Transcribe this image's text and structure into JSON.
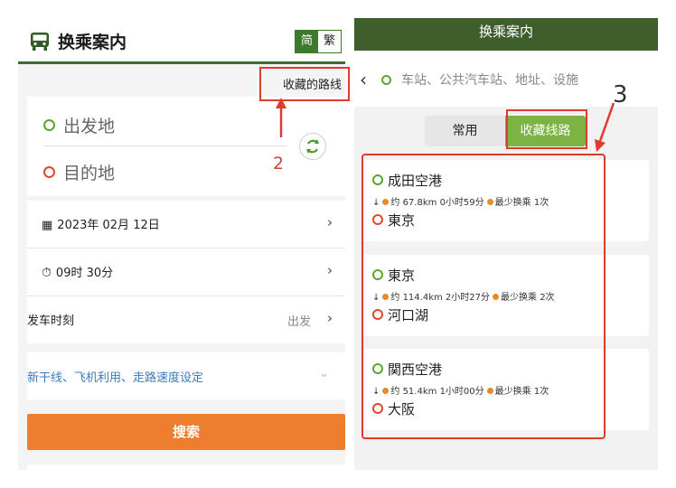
{
  "left": {
    "title": "换乘案内",
    "lang": {
      "simplified": "简",
      "traditional": "繁"
    },
    "fav_routes_link": "收藏的路线",
    "origin_placeholder": "出发地",
    "destination_placeholder": "目的地",
    "date": "2023年 02月 12日",
    "time": "09时 30分",
    "depart_label": "发车时刻",
    "depart_value": "出发",
    "options_text": "新干线、飞机利用、走路速度设定",
    "search_button": "搜索",
    "chevron": "›"
  },
  "right": {
    "title": "换乘案内",
    "search_placeholder": "车站、公共汽车站、地址、设施",
    "tabs": {
      "common": "常用",
      "favorite": "收藏线路"
    },
    "routes": [
      {
        "from": "成田空港",
        "distance": "约 67.8km",
        "duration": "0小时59分",
        "transfers": "最少换乘 1次",
        "to": "東京"
      },
      {
        "from": "東京",
        "distance": "约 114.4km",
        "duration": "2小时27分",
        "transfers": "最少换乘 2次",
        "to": "河口湖"
      },
      {
        "from": "関西空港",
        "distance": "约 51.4km",
        "duration": "1小时00分",
        "transfers": "最少换乘 1次",
        "to": "大阪"
      }
    ]
  },
  "annotations": {
    "step2": "2",
    "step3": "3",
    "color": "#e03a2b"
  },
  "colors": {
    "brand_green": "#3e6b33",
    "accent_green": "#7cb342",
    "orange": "#ee7e2f",
    "link_blue": "#3a7bbf"
  }
}
